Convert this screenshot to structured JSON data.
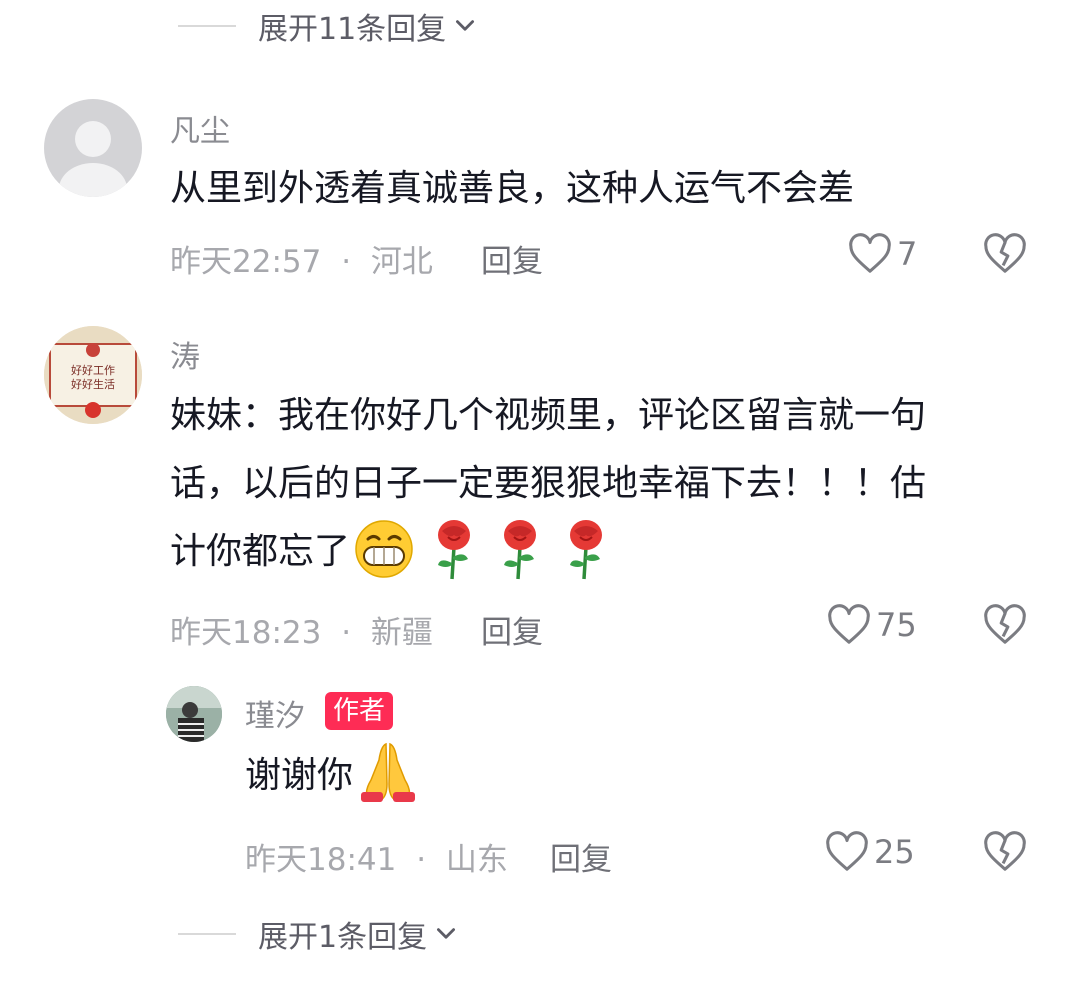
{
  "top_expand": {
    "label": "展开11条回复"
  },
  "comments": [
    {
      "username": "凡尘",
      "text": "从里到外透着真诚善良，这种人运气不会差",
      "time": "昨天22:57",
      "location": "河北",
      "reply_label": "回复",
      "likes": "7"
    },
    {
      "username": "涛",
      "avatar_text": [
        "好好工作",
        "好好生活"
      ],
      "text_lines": [
        "妹妹：我在你好几个视频里，评论区留言就一句",
        "话，以后的日子一定要狠狠地幸福下去！！！估",
        "计你都忘了"
      ],
      "time": "昨天18:23",
      "location": "新疆",
      "reply_label": "回复",
      "likes": "75"
    }
  ],
  "author_reply": {
    "username": "瑾汐",
    "badge": "作者",
    "text": "谢谢你",
    "time": "昨天18:41",
    "location": "山东",
    "reply_label": "回复",
    "likes": "25"
  },
  "bottom_expand": {
    "label": "展开1条回复"
  },
  "separator": "·",
  "colors": {
    "accent": "#fe2c55",
    "meta": "#a7a8ad"
  },
  "icons": [
    "chevron-down-icon",
    "heart-icon",
    "broken-heart-icon",
    "grinning-emoji",
    "rose-emoji",
    "praying-hands-emoji"
  ]
}
